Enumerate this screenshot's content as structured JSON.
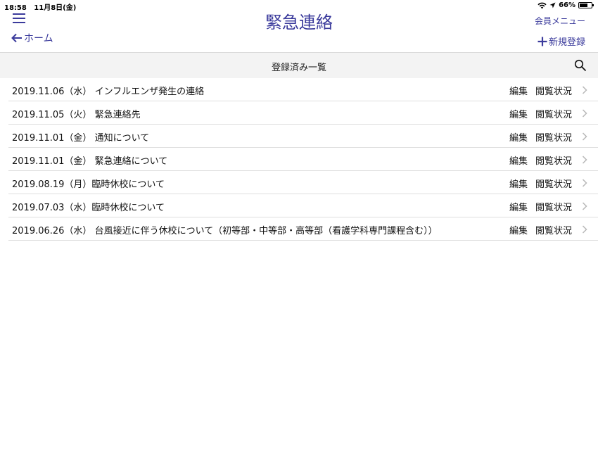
{
  "status_bar": {
    "time": "18:58",
    "date": "11月8日(金)",
    "battery": "66%",
    "battery_level": 0.66
  },
  "nav": {
    "title": "緊急連絡",
    "back_label": "ホーム",
    "member_menu_label": "会員メニュー",
    "new_register_label": "新規登録"
  },
  "section": {
    "title": "登録済み一覧"
  },
  "list": {
    "edit_label": "編集",
    "status_label": "閲覧状況",
    "items": [
      {
        "title": "2019.11.06（水） インフルエンザ発生の連絡"
      },
      {
        "title": "2019.11.05（火） 緊急連絡先"
      },
      {
        "title": "2019.11.01（金） 通知について"
      },
      {
        "title": "2019.11.01（金） 緊急連絡について"
      },
      {
        "title": "2019.08.19（月）臨時休校について"
      },
      {
        "title": "2019.07.03（水）臨時休校について"
      },
      {
        "title": "2019.06.26（水） 台風接近に伴う休校について（初等部・中等部・高等部（看護学科専門課程含む））"
      }
    ]
  },
  "colors": {
    "accent": "#3b3b9c",
    "header_bg": "#f3f3f3",
    "separator": "#dedede"
  }
}
